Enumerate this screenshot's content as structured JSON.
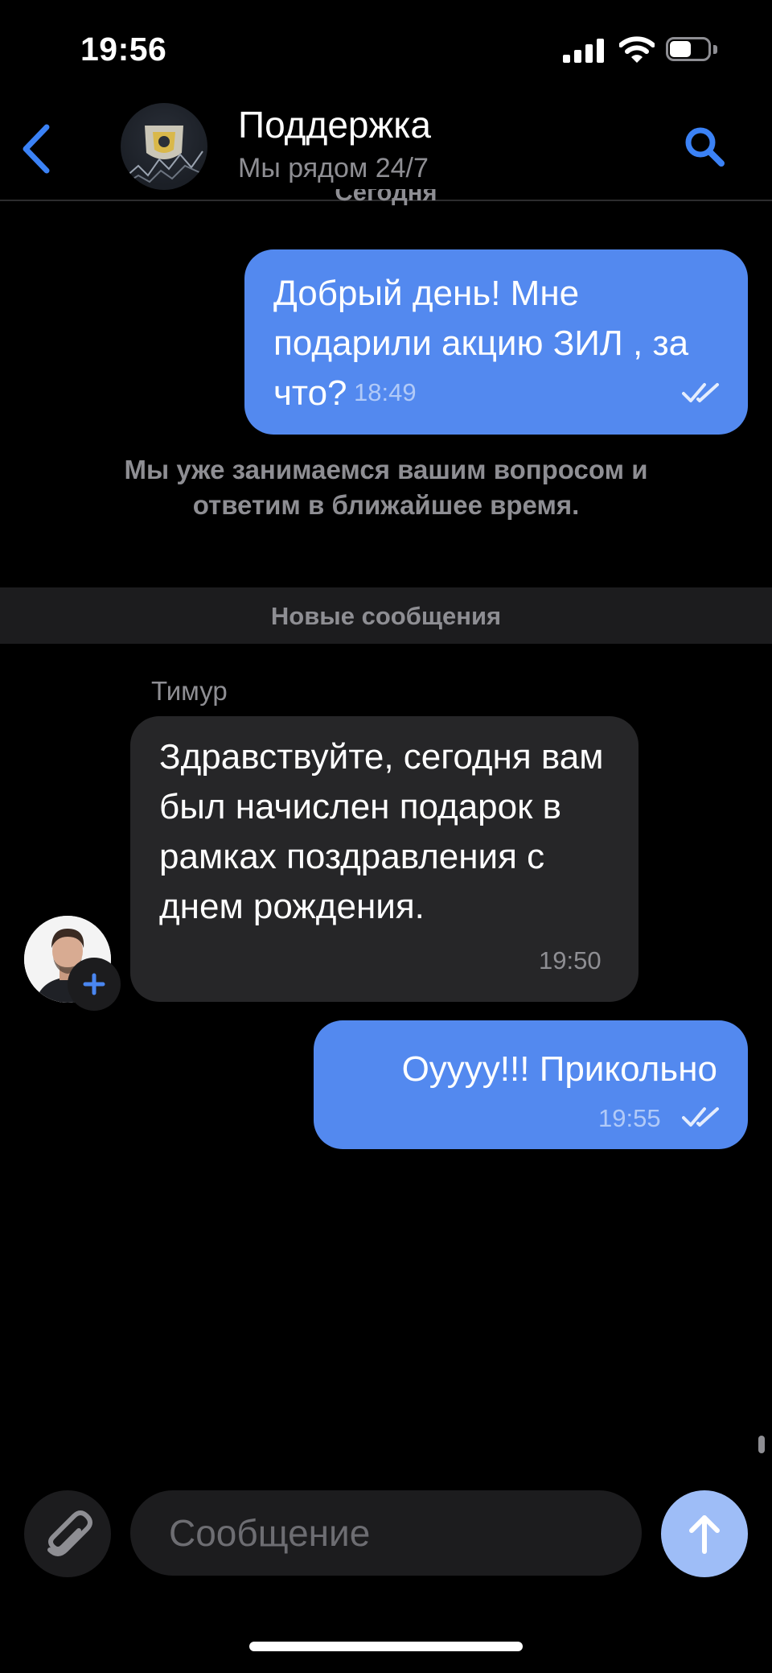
{
  "status_bar": {
    "time": "19:56"
  },
  "header": {
    "title": "Поддержка",
    "subtitle": "Мы рядом 24/7",
    "back_icon": "chevron-left-icon",
    "search_icon": "search-icon"
  },
  "chat": {
    "date_label": "Сегодня",
    "messages": [
      {
        "direction": "out",
        "text": "Добрый день! Мне подарили акцию ЗИЛ , за что?",
        "time": "18:49",
        "status": "read"
      },
      {
        "direction": "in",
        "sender": "Тимур",
        "text": "Здравствуйте, сегодня вам был начислен подарок в рамках поздравления с днем рождения.",
        "time": "19:50"
      },
      {
        "direction": "out",
        "text": "Оуууу!!! Прикольно",
        "time": "19:55",
        "status": "read"
      }
    ],
    "system_note": "Мы уже занимаемся вашим вопросом и ответим в ближайшее время.",
    "new_messages_label": "Новые сообщения"
  },
  "composer": {
    "placeholder": "Сообщение",
    "attach_icon": "paperclip-icon",
    "send_icon": "arrow-up-icon"
  },
  "colors": {
    "outgoing_bubble": "#5389ef",
    "incoming_bubble": "#262628",
    "accent": "#3b82f6",
    "send_button": "#9ebdf7"
  }
}
